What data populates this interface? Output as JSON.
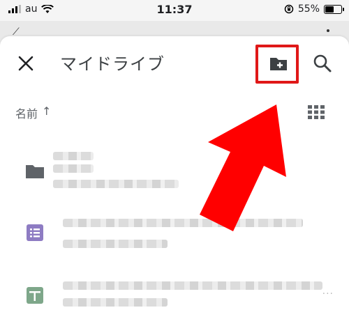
{
  "status_bar": {
    "carrier": "au",
    "time": "11:37",
    "battery_percent": "55%",
    "battery_level": 0.55
  },
  "header": {
    "title": "マイドライブ",
    "icons": [
      "close-icon",
      "new-folder-icon",
      "search-icon"
    ]
  },
  "sort": {
    "label": "名前",
    "direction_glyph": "↑",
    "view_toggle_icon": "grid-view-icon"
  },
  "files": [
    {
      "icon": "folder-icon",
      "icon_color": "#5f6368"
    },
    {
      "icon": "list-doc-icon",
      "icon_color": "#8e7cc3"
    },
    {
      "icon": "sheets-icon",
      "icon_color": "#7ea78a"
    }
  ],
  "more_glyph": "···",
  "colors": {
    "highlight": "#e01818",
    "arrow": "#ff0000",
    "icon_gray": "#5f6368"
  }
}
